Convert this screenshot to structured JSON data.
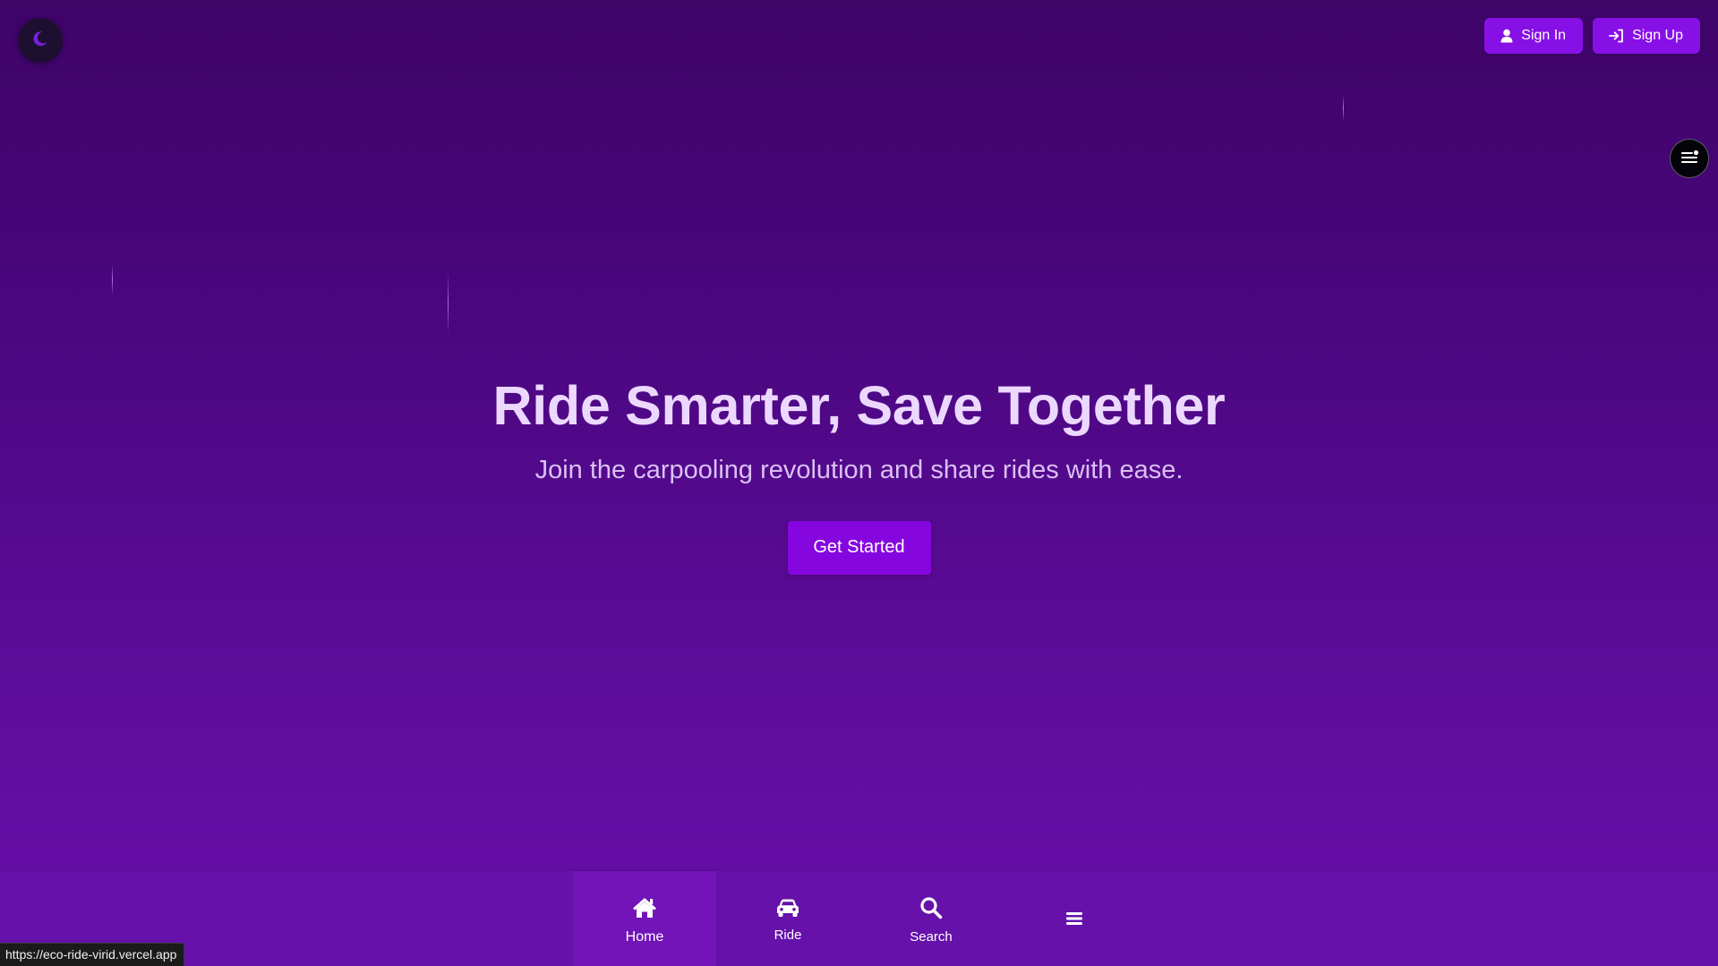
{
  "header": {
    "theme_toggle_icon": "moon-icon",
    "sign_in_label": "Sign In",
    "sign_in_icon": "user-icon",
    "sign_up_label": "Sign Up",
    "sign_up_icon": "sign-in-arrow-icon"
  },
  "floating_menu": {
    "icon": "menu-lines-icon"
  },
  "hero": {
    "title": "Ride Smarter, Save Together",
    "subtitle": "Join the carpooling revolution and share rides with ease.",
    "cta_label": "Get Started"
  },
  "bottom_nav": {
    "items": [
      {
        "label": "Home",
        "icon": "home-icon",
        "active": true
      },
      {
        "label": "Ride",
        "icon": "car-icon",
        "active": false
      },
      {
        "label": "Search",
        "icon": "search-icon",
        "active": false
      },
      {
        "label": "",
        "icon": "hamburger-icon",
        "active": false
      }
    ]
  },
  "status_bar": {
    "url": "https://eco-ride-virid.vercel.app"
  },
  "colors": {
    "accent": "#8710e6",
    "background_top": "#3e0468",
    "background_bottom": "#6810ac",
    "title": "#ecd8ff"
  }
}
